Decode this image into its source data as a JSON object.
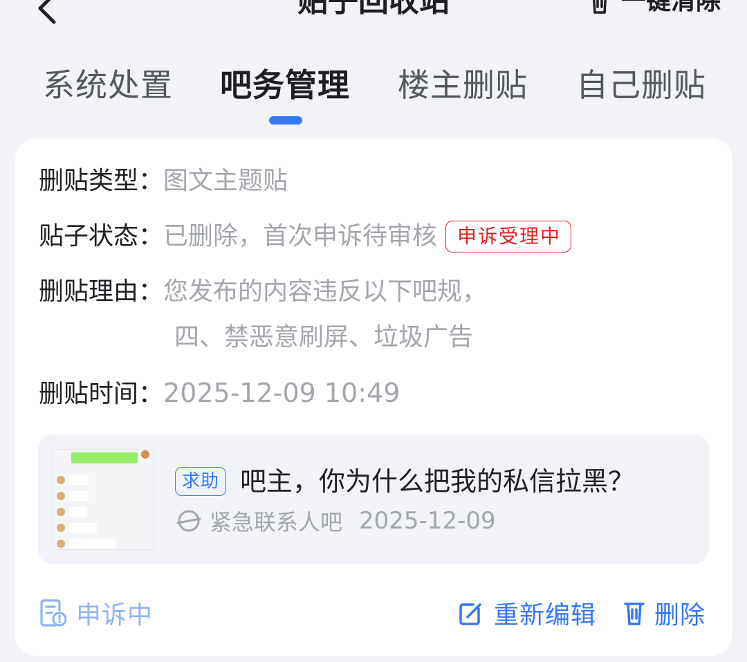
{
  "header": {
    "title": "贴子回收站",
    "clear_all_label": "一键清除"
  },
  "tabs": [
    {
      "label": "系统处置",
      "active": false
    },
    {
      "label": "吧务管理",
      "active": true
    },
    {
      "label": "楼主删贴",
      "active": false
    },
    {
      "label": "自己删贴",
      "active": false
    }
  ],
  "record": {
    "delete_type": {
      "key": "删贴类型：",
      "value": "图文主题贴"
    },
    "post_status": {
      "key": "贴子状态：",
      "value": "已删除，首次申诉待审核",
      "badge": "申诉受理中"
    },
    "delete_reason": {
      "key": "删贴理由：",
      "line1": "您发布的内容违反以下吧规，",
      "line2": "四、禁恶意刷屏、垃圾广告"
    },
    "delete_time": {
      "key": "删贴时间：",
      "value": "2025-12-09 10:49"
    }
  },
  "post": {
    "tag": "求助",
    "title": "吧主，你为什么把我的私信拉黑？",
    "forum": "紧急联系人吧",
    "date": "2025-12-09"
  },
  "actions": {
    "status_label": "申诉中",
    "edit_label": "重新编辑",
    "delete_label": "删除"
  },
  "colors": {
    "accent": "#3478f6",
    "badge_red": "#e02020",
    "muted_text": "#a3a6ad",
    "page_bg": "#f1f3f8"
  }
}
